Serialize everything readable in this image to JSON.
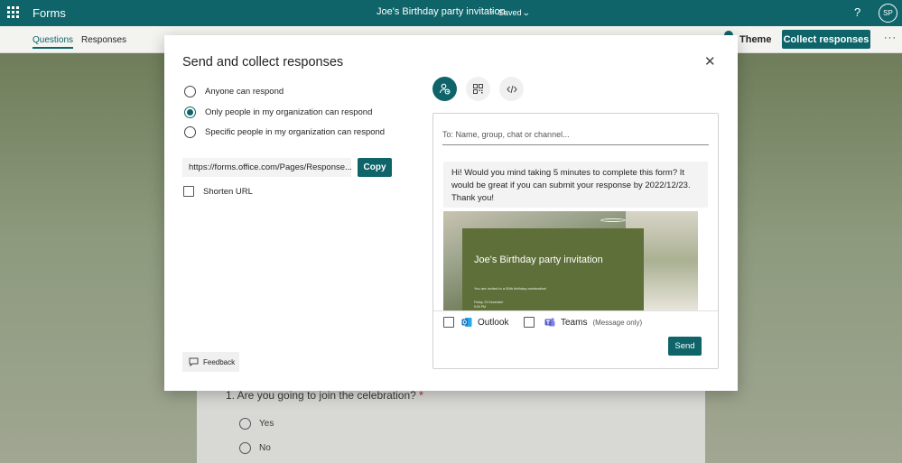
{
  "app": {
    "name": "Forms",
    "help_label": "?",
    "avatar_initials": "SP"
  },
  "document": {
    "title": "Joe's Birthday party invitation",
    "separator": "-",
    "status": "Saved"
  },
  "tabs": [
    {
      "label": "Questions",
      "selected": true
    },
    {
      "label": "Responses",
      "selected": false
    }
  ],
  "toolbar": {
    "theme_label": "Theme",
    "collect_label": "Collect responses",
    "more_label": "···"
  },
  "background_form": {
    "question_title": "1.  Are you going to join the celebration?",
    "required_mark": "*",
    "options": [
      "Yes",
      "No"
    ]
  },
  "dialog": {
    "title": "Send and collect responses",
    "close_label": "✕",
    "audience": [
      {
        "label": "Anyone can respond",
        "selected": false
      },
      {
        "label": "Only people in my organization can respond",
        "selected": true
      },
      {
        "label": "Specific people in my organization can respond",
        "selected": false
      }
    ],
    "link": {
      "url": "https://forms.office.com/Pages/Response...",
      "copy_label": "Copy"
    },
    "shorten_url": {
      "label": "Shorten URL",
      "checked": false
    },
    "feedback_label": "Feedback",
    "share_tabs": [
      {
        "icon": "person-share-icon",
        "active": true
      },
      {
        "icon": "qr-code-icon",
        "active": false
      },
      {
        "icon": "embed-code-icon",
        "active": false
      }
    ],
    "share_panel": {
      "to_placeholder": "To: Name, group, chat or channel...",
      "message": "Hi! Would you mind taking 5 minutes to complete this form? It would be great if you can submit your response by 2022/12/23. Thank you!",
      "preview": {
        "title": "Joe's Birthday party invitation",
        "subtitle": "You are invited to a 50th birthday celebration!",
        "date_line1": "Friday, 23 December",
        "date_line2": "5:00 PM"
      },
      "channels": [
        {
          "label": "Outlook",
          "note": "",
          "checked": false
        },
        {
          "label": "Teams",
          "note": "(Message only)",
          "checked": false
        }
      ],
      "send_label": "Send"
    }
  },
  "colors": {
    "accent": "#0e6469",
    "topbar": "#0e6469",
    "outlook_blue": "#0f6cbd",
    "teams_purple": "#5b5fc7"
  }
}
